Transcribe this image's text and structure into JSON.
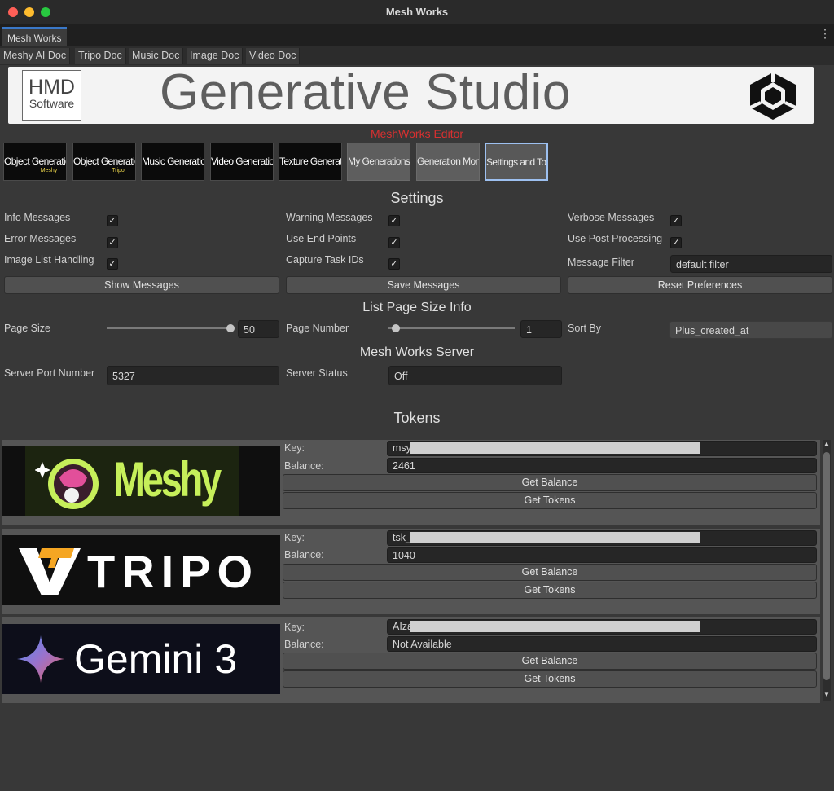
{
  "window": {
    "title": "Mesh Works"
  },
  "editor_tab": {
    "label": "Mesh Works",
    "menu_icon": "kebab-menu-icon"
  },
  "doc_tabs": [
    "Meshy AI Doc",
    "Tripo Doc",
    "Music Doc",
    "Image Doc",
    "Video Doc"
  ],
  "banner": {
    "company_line1": "HMD",
    "company_line2": "Software",
    "title": "Generative Studio",
    "engine_icon": "unity-logo-icon"
  },
  "subtitle": "MeshWorks Editor",
  "gen_buttons": [
    {
      "label": "Object Generation",
      "tag": "Meshy"
    },
    {
      "label": "Object Generation",
      "tag": "Tripo"
    },
    {
      "label": "Music Generation",
      "tag": ""
    },
    {
      "label": "Video Generation",
      "tag": ""
    },
    {
      "label": "Texture Generation",
      "tag": ""
    },
    {
      "label": "My Generations",
      "tag": ""
    },
    {
      "label": "Generation Monitor",
      "tag": ""
    },
    {
      "label": "Settings and Tokens",
      "tag": ""
    }
  ],
  "settings": {
    "title": "Settings",
    "checks": [
      {
        "label": "Info Messages",
        "checked": true
      },
      {
        "label": "Error Messages",
        "checked": true
      },
      {
        "label": "Image List Handling",
        "checked": true
      },
      {
        "label": "Warning Messages",
        "checked": true
      },
      {
        "label": "Use End Points",
        "checked": true
      },
      {
        "label": "Capture Task IDs",
        "checked": true
      },
      {
        "label": "Verbose Messages",
        "checked": true
      },
      {
        "label": "Use Post Processing",
        "checked": true
      }
    ],
    "message_filter_label": "Message Filter",
    "message_filter_value": "default filter",
    "show_messages": "Show Messages",
    "save_messages": "Save Messages",
    "reset_preferences": "Reset Preferences"
  },
  "list_page": {
    "title": "List Page Size Info",
    "page_size_label": "Page Size",
    "page_size_value": "50",
    "page_number_label": "Page Number",
    "page_number_value": "1",
    "sort_by_label": "Sort By",
    "sort_by_value": "Plus_created_at"
  },
  "server": {
    "title": "Mesh Works Server",
    "port_label": "Server Port Number",
    "port_value": "5327",
    "status_label": "Server Status",
    "status_value": "Off"
  },
  "tokens": {
    "title": "Tokens",
    "key_label": "Key:",
    "balance_label": "Balance:",
    "get_balance": "Get Balance",
    "get_tokens": "Get Tokens",
    "providers": [
      {
        "name": "Meshy",
        "key_prefix": "msy",
        "balance": "2461"
      },
      {
        "name": "TRIPO",
        "key_prefix": "tsk_",
        "balance": "1040"
      },
      {
        "name": "Gemini 3",
        "key_prefix": "AIza",
        "balance": "Not Available"
      }
    ]
  },
  "colors": {
    "background": "#383838",
    "subtitle_red": "#d83030",
    "meshy_green": "#c6ef5a",
    "selected_outline": "#9dc0f0"
  }
}
